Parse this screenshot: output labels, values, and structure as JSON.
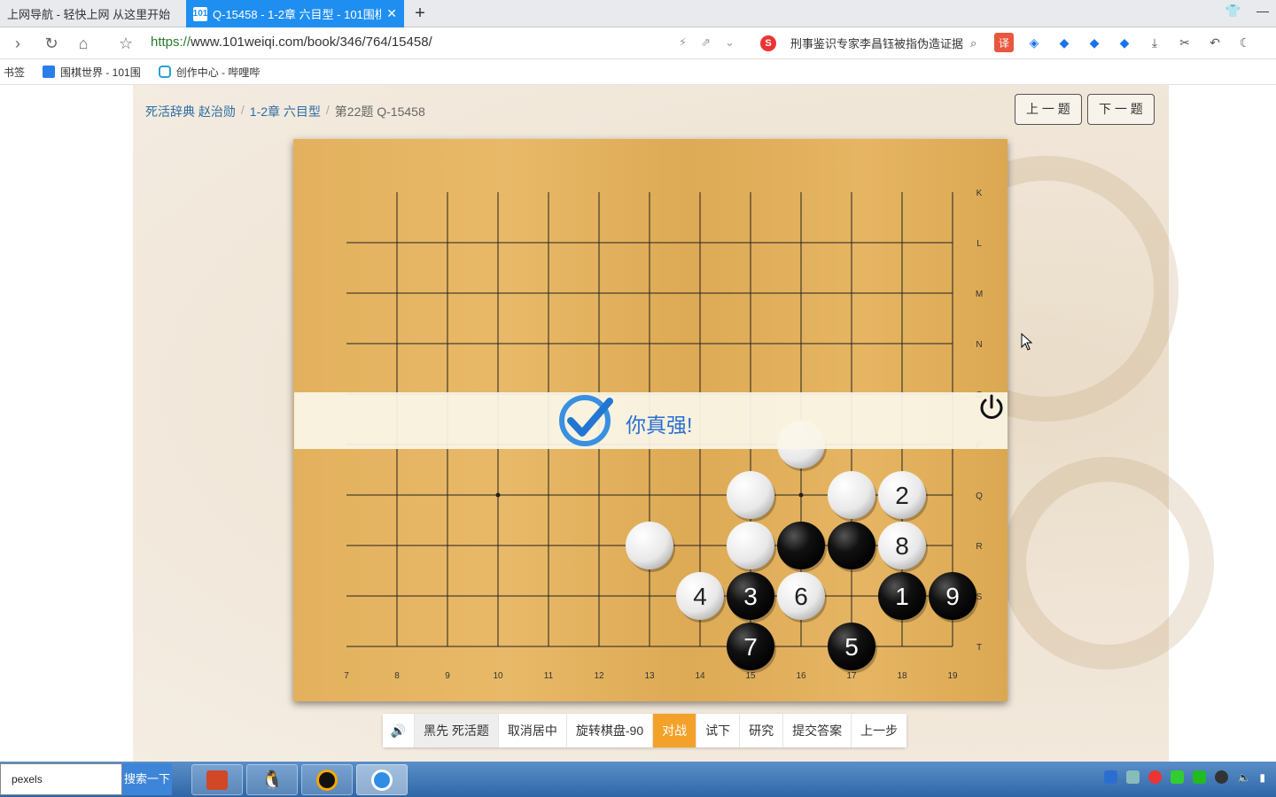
{
  "browser": {
    "tabs": [
      {
        "label": "上网导航 - 轻快上网 从这里开始",
        "active": false
      },
      {
        "label": "Q-15458 - 1-2章 六目型 - 101围棋",
        "active": true
      }
    ],
    "new_tab": "+",
    "url_prefix": "https://",
    "url_rest": "www.101weiqi.com/book/346/764/15458/",
    "news_ticker": "刑事鉴识专家李昌钰被指伪造证据",
    "translate_icon": "译",
    "bookmarks": [
      "书签",
      "围棋世界 - 101围",
      "创作中心 - 哔哩哔"
    ]
  },
  "page": {
    "breadcrumb": [
      "死活辞典 赵治勋",
      "1-2章 六目型",
      "第22题 Q-15458"
    ],
    "prev_button": "上 一 题",
    "next_button": "下 一 题",
    "banner_message": "你真强!",
    "controls": [
      "黑先 死活题",
      "取消居中",
      "旋转棋盘-90",
      "对战",
      "试下",
      "研究",
      "提交答案",
      "上一步"
    ],
    "active_control": "对战"
  },
  "board": {
    "col_labels": [
      "7",
      "8",
      "9",
      "10",
      "11",
      "12",
      "13",
      "14",
      "15",
      "16",
      "17",
      "18",
      "19"
    ],
    "row_labels": [
      "K",
      "L",
      "M",
      "N",
      "O",
      "P",
      "Q",
      "R",
      "S",
      "T"
    ],
    "stones": [
      {
        "col": "16",
        "row": "P",
        "color": "white",
        "num": ""
      },
      {
        "col": "15",
        "row": "Q",
        "color": "white",
        "num": ""
      },
      {
        "col": "17",
        "row": "Q",
        "color": "white",
        "num": ""
      },
      {
        "col": "18",
        "row": "Q",
        "color": "white",
        "num": "2"
      },
      {
        "col": "13",
        "row": "R",
        "color": "white",
        "num": ""
      },
      {
        "col": "15",
        "row": "R",
        "color": "white",
        "num": ""
      },
      {
        "col": "16",
        "row": "R",
        "color": "black",
        "num": ""
      },
      {
        "col": "17",
        "row": "R",
        "color": "black",
        "num": ""
      },
      {
        "col": "18",
        "row": "R",
        "color": "white",
        "num": "8"
      },
      {
        "col": "14",
        "row": "S",
        "color": "white",
        "num": "4"
      },
      {
        "col": "15",
        "row": "S",
        "color": "black",
        "num": "3"
      },
      {
        "col": "16",
        "row": "S",
        "color": "white",
        "num": "6"
      },
      {
        "col": "18",
        "row": "S",
        "color": "black",
        "num": "1"
      },
      {
        "col": "19",
        "row": "S",
        "color": "black",
        "num": "9"
      },
      {
        "col": "15",
        "row": "T",
        "color": "black",
        "num": "7"
      },
      {
        "col": "17",
        "row": "T",
        "color": "black",
        "num": "5"
      }
    ],
    "star_points": [
      [
        "10",
        "Q"
      ],
      [
        "16",
        "Q"
      ]
    ]
  },
  "taskbar": {
    "search_value": "pexels",
    "search_button": "搜索一下"
  },
  "colors": {
    "accent_blue": "#1f8ef1",
    "active_orange": "#f4a12a",
    "link_blue": "#2e6da4",
    "board_wood": "#e3b15e"
  }
}
